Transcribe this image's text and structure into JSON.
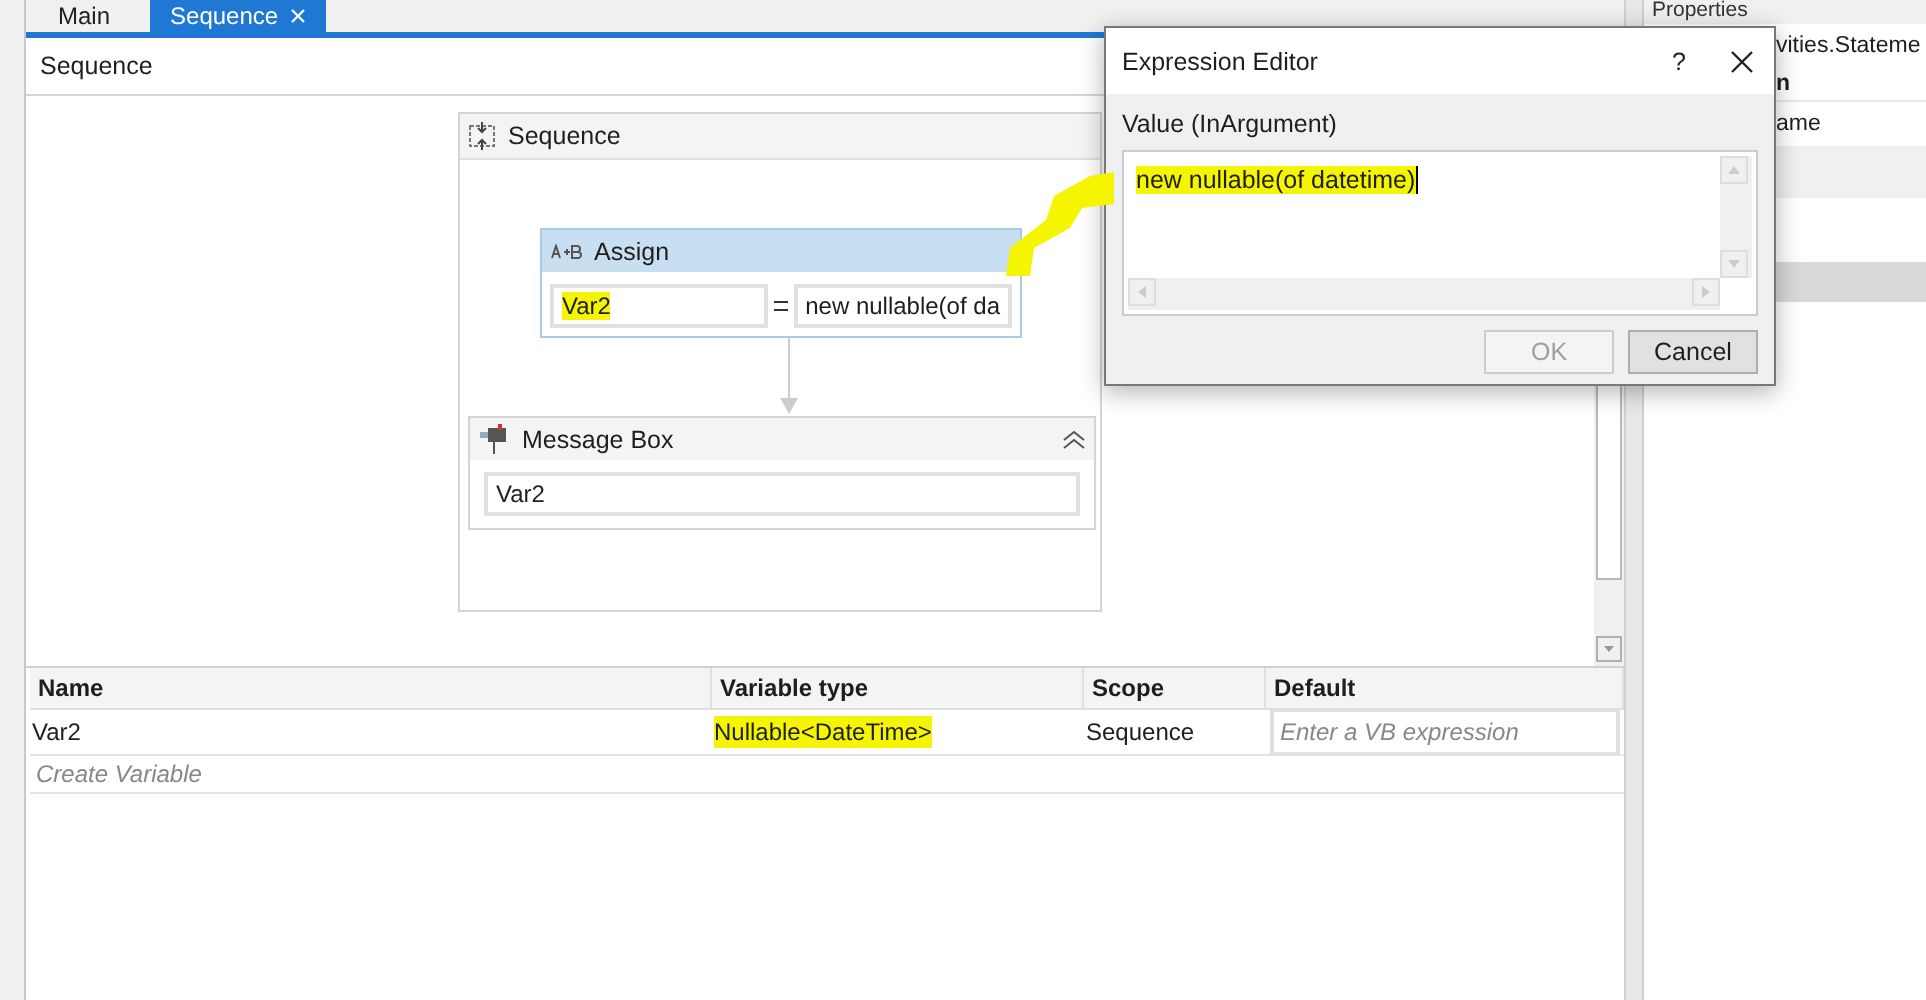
{
  "tabs": [
    {
      "label": "Main",
      "selected": false,
      "closable": false
    },
    {
      "label": "Sequence",
      "selected": true,
      "closable": true
    }
  ],
  "breadcrumb": "Sequence",
  "sequence": {
    "title": "Sequence",
    "activities": [
      {
        "kind": "assign",
        "title": "Assign",
        "to": {
          "value": "Var2",
          "highlighted": true
        },
        "value": {
          "value": "new nullable(of da",
          "highlighted": false
        }
      },
      {
        "kind": "message_box",
        "title": "Message Box",
        "text": {
          "value": "Var2",
          "highlighted": false
        }
      }
    ]
  },
  "variables": {
    "columns": [
      "Name",
      "Variable type",
      "Scope",
      "Default"
    ],
    "rows": [
      {
        "name": "Var2",
        "type": {
          "value": "Nullable<DateTime>",
          "highlighted": true
        },
        "scope": "Sequence",
        "default_placeholder": "Enter a VB expression"
      }
    ],
    "create_label": "Create Variable"
  },
  "properties": {
    "title": "Properties",
    "lines": [
      {
        "kind": "text",
        "text": "vities.Stateme"
      },
      {
        "kind": "category",
        "text": "n"
      },
      {
        "kind": "row",
        "text": "ame"
      }
    ]
  },
  "dialog": {
    "title": "Expression Editor",
    "help": "?",
    "label": "Value (InArgument)",
    "value": "new nullable(of datetime)",
    "highlighted": true,
    "buttons": [
      {
        "label": "OK",
        "disabled": true
      },
      {
        "label": "Cancel",
        "disabled": false
      }
    ]
  }
}
